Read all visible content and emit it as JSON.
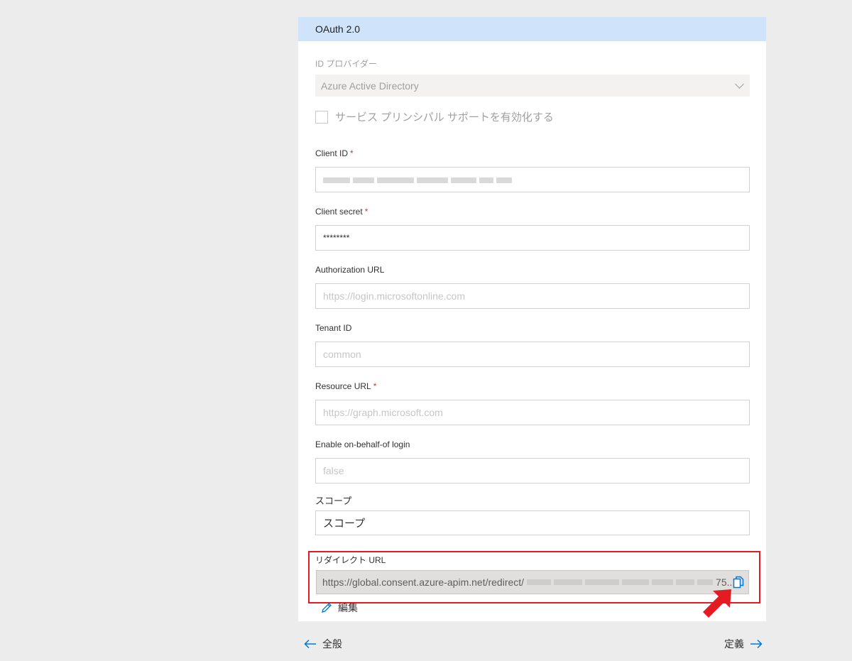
{
  "header": {
    "title": "OAuth 2.0"
  },
  "identity_provider": {
    "label": "ID プロバイダー",
    "value": "Azure Active Directory"
  },
  "service_principal": {
    "label": "サービス プリンシパル サポートを有効化する",
    "checked": false
  },
  "client_id": {
    "label": "Client ID",
    "required_mark": "*",
    "value": ""
  },
  "client_secret": {
    "label": "Client secret",
    "required_mark": "*",
    "value": "********"
  },
  "authorization_url": {
    "label": "Authorization URL",
    "placeholder": "https://login.microsoftonline.com"
  },
  "tenant_id": {
    "label": "Tenant ID",
    "placeholder": "common"
  },
  "resource_url": {
    "label": "Resource URL",
    "required_mark": "*",
    "placeholder": "https://graph.microsoft.com"
  },
  "on_behalf_of": {
    "label": "Enable on-behalf-of login",
    "placeholder": "false"
  },
  "scope": {
    "label": "スコープ",
    "value": "スコープ"
  },
  "redirect_url": {
    "label": "リダイレクト URL",
    "value_prefix": "https://global.consent.azure-apim.net/redirect/",
    "value_suffix": "75...",
    "copy_icon": "copy-icon"
  },
  "edit": {
    "label": "編集",
    "icon": "pencil-icon"
  },
  "nav": {
    "back_label": "全般",
    "next_label": "定義"
  },
  "colors": {
    "header_bg": "#cfe4fa",
    "accent": "#0078d4",
    "highlight": "#e31c23",
    "required": "#d13438"
  }
}
